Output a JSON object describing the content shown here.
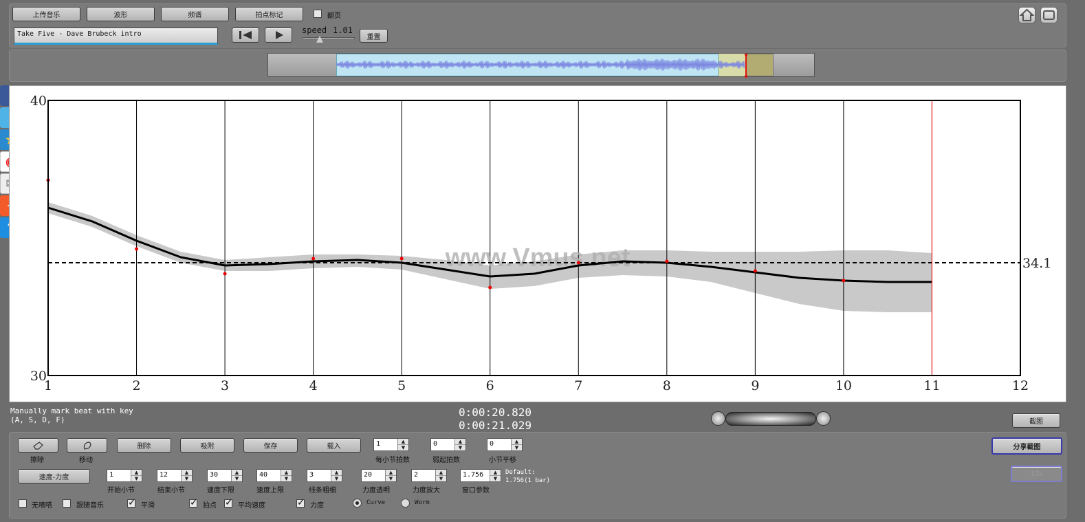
{
  "top_toolbar": {
    "upload_label": "上传音乐",
    "waveform_label": "波形",
    "spectrum_label": "频谱",
    "beat_mark_label": "拍点标记",
    "page_flip_label": "翻页",
    "track_title": "Take Five - Dave Brubeck intro",
    "speed_label": "speed",
    "speed_value": "1.01",
    "reset_label": "重置"
  },
  "chart_data": {
    "type": "line",
    "x_ticks": [
      "1",
      "2",
      "3",
      "4",
      "5",
      "6",
      "7",
      "8",
      "9",
      "10",
      "11",
      "12"
    ],
    "y_ticks": [
      "30",
      "40"
    ],
    "xlim": [
      1,
      12
    ],
    "ylim": [
      30,
      40
    ],
    "watermark": "www.Vmus.net",
    "mean_label": "34.1",
    "mean_value": 34.1,
    "cursor_x": 11,
    "grid": "vertical",
    "series": [
      {
        "role": "smoothed",
        "x": [
          1,
          1.5,
          2,
          2.5,
          3,
          3.5,
          4,
          4.5,
          5,
          5.5,
          6,
          6.5,
          7,
          7.5,
          8,
          8.5,
          9,
          9.5,
          10,
          10.5,
          11
        ],
        "y": [
          36.1,
          35.6,
          34.9,
          34.3,
          34.0,
          34.05,
          34.15,
          34.2,
          34.1,
          33.85,
          33.6,
          33.7,
          34.0,
          34.15,
          34.1,
          33.95,
          33.75,
          33.55,
          33.45,
          33.4,
          33.4
        ]
      },
      {
        "role": "band_upper",
        "x": [
          1,
          1.5,
          2,
          2.5,
          3,
          3.5,
          4,
          4.5,
          5,
          5.5,
          6,
          6.5,
          7,
          7.5,
          8,
          8.5,
          9,
          9.5,
          10,
          10.5,
          11
        ],
        "y": [
          36.3,
          35.8,
          35.1,
          34.5,
          34.2,
          34.3,
          34.4,
          34.4,
          34.35,
          34.2,
          34.0,
          34.15,
          34.4,
          34.55,
          34.55,
          34.5,
          34.5,
          34.5,
          34.55,
          34.55,
          34.45
        ]
      },
      {
        "role": "band_lower",
        "x": [
          1,
          1.5,
          2,
          2.5,
          3,
          3.5,
          4,
          4.5,
          5,
          5.5,
          6,
          6.5,
          7,
          7.5,
          8,
          8.5,
          9,
          9.5,
          10,
          10.5,
          11
        ],
        "y": [
          35.9,
          35.4,
          34.7,
          34.1,
          33.8,
          33.8,
          33.9,
          33.95,
          33.85,
          33.5,
          33.15,
          33.25,
          33.55,
          33.65,
          33.6,
          33.4,
          33.0,
          32.6,
          32.35,
          32.3,
          32.3
        ]
      },
      {
        "role": "beat_points",
        "x": [
          1,
          2,
          3,
          4,
          5,
          6,
          7,
          8,
          9,
          10
        ],
        "y": [
          37.1,
          34.6,
          33.7,
          34.25,
          34.25,
          33.2,
          34.1,
          34.15,
          33.8,
          33.45
        ]
      }
    ]
  },
  "status": {
    "hint_line1": "Manually mark beat with key",
    "hint_line2": "(A, S, D, F)",
    "time_current": "0:00:20.820",
    "time_second": "0:00:21.029",
    "screenshot_label": "截图"
  },
  "bottom": {
    "erase_label": "擦除",
    "move_label": "移动",
    "delete_label": "删除",
    "snap_label": "吸附",
    "save_label": "保存",
    "load_label": "载入",
    "beats_per_bar_value": "1",
    "beats_per_bar_label": "每小节拍数",
    "weak_beat_value": "0",
    "weak_beat_label": "弱起拍数",
    "bar_shift_value": "0",
    "bar_shift_label": "小节平移",
    "share_label": "分享截图",
    "disabled_label": "10s",
    "mode_label": "速度-力度",
    "start_bar_value": "1",
    "start_bar_label": "开始小节",
    "end_bar_value": "12",
    "end_bar_label": "结束小节",
    "tempo_min_value": "30",
    "tempo_min_label": "速度下限",
    "tempo_max_value": "40",
    "tempo_max_label": "速度上限",
    "line_width_value": "3",
    "line_width_label": "线条粗细",
    "dyn_alpha_value": "20",
    "dyn_alpha_label": "力度透明",
    "dyn_scale_value": "2",
    "dyn_scale_label": "力度放大",
    "window_value": "1.756",
    "window_label": "窗口参数",
    "default_line1": "Default:",
    "default_line2": "1.756(1 bar)",
    "cb_no_vibrato": "无嘀嗒",
    "cb_follow_music": "跟随音乐",
    "cb_smooth": "平滑",
    "cb_beats": "拍点",
    "cb_avg_tempo": "平均速度",
    "cb_dynamics": "力度",
    "radio_curve": "Curve",
    "radio_worm": "Worm"
  },
  "social_icons": [
    "facebook-icon",
    "twitter-icon",
    "favorite-icon",
    "weibo-icon",
    "mail-icon",
    "plus-icon",
    "help-icon"
  ]
}
